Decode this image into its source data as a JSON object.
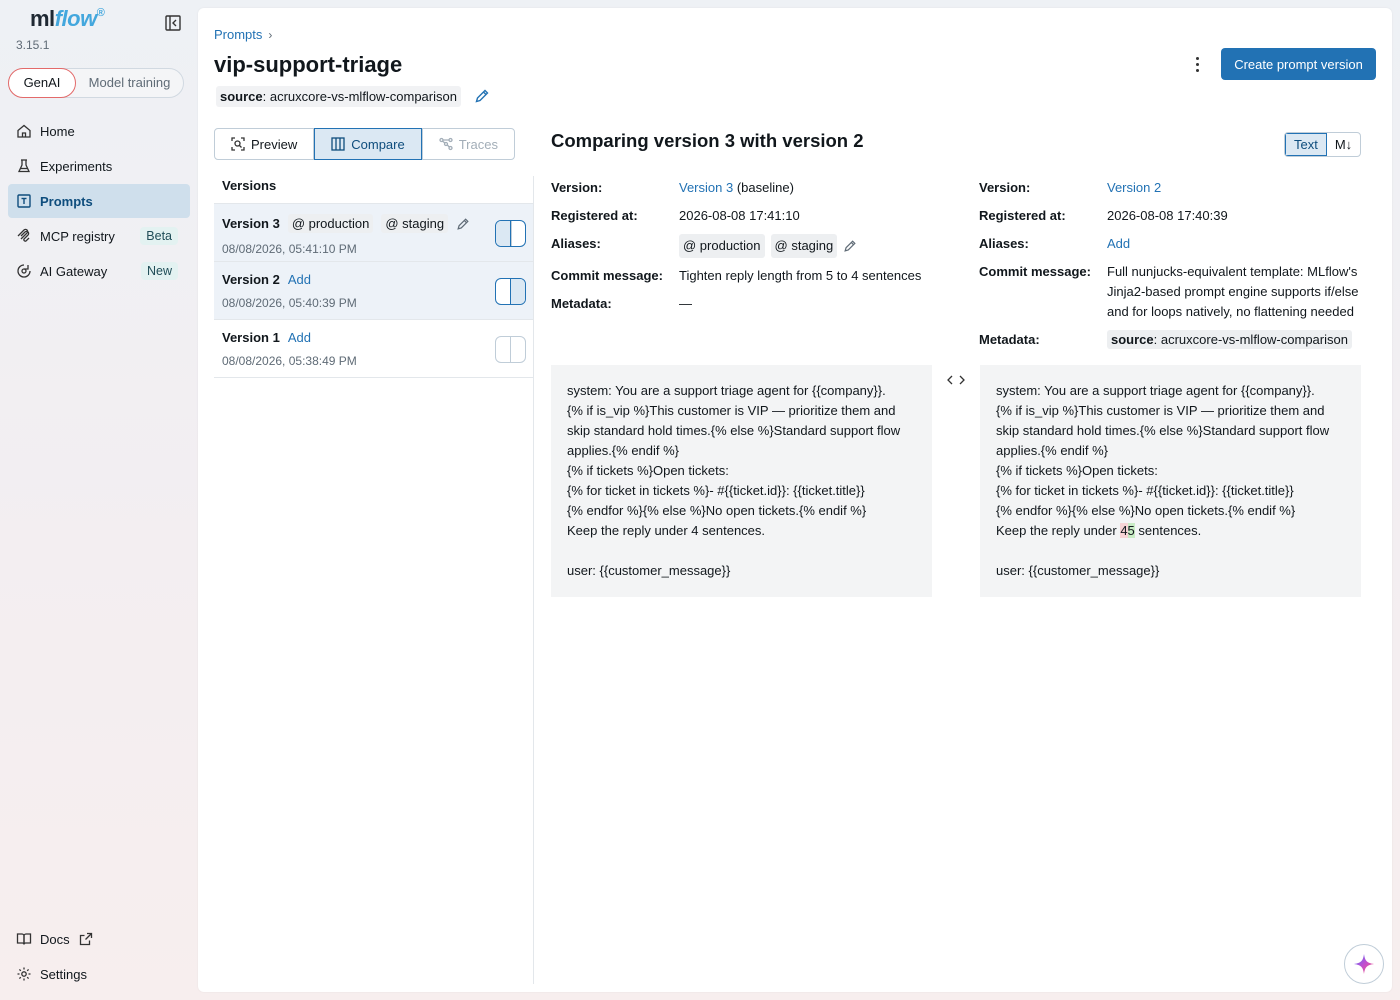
{
  "sidebar": {
    "logo": "mlflow",
    "version": "3.15.1",
    "modes": {
      "genai": "GenAI",
      "training": "Model training"
    },
    "items": [
      {
        "label": "Home",
        "icon": "home-icon"
      },
      {
        "label": "Experiments",
        "icon": "flask-icon"
      },
      {
        "label": "Prompts",
        "icon": "prompt-icon",
        "active": true
      },
      {
        "label": "MCP registry",
        "icon": "mcp-icon",
        "tag": "Beta"
      },
      {
        "label": "AI Gateway",
        "icon": "gateway-icon",
        "tag": "New"
      }
    ],
    "bottom": [
      {
        "label": "Docs",
        "icon": "book-icon"
      },
      {
        "label": "Settings",
        "icon": "gear-icon"
      }
    ]
  },
  "header": {
    "breadcrumb": "Prompts",
    "title": "vip-support-triage",
    "create_button": "Create prompt version",
    "tag": {
      "key": "source",
      "value": ": acruxcore-vs-mlflow-comparison"
    }
  },
  "toolbar": {
    "preview": "Preview",
    "compare": "Compare",
    "traces": "Traces"
  },
  "versions": {
    "header": "Versions",
    "rows": [
      {
        "name": "Version 3",
        "aliases": [
          "@ production",
          "@ staging"
        ],
        "date": "08/08/2026, 05:41:10 PM"
      },
      {
        "name": "Version 2",
        "add": "Add",
        "date": "08/08/2026, 05:40:39 PM"
      },
      {
        "name": "Version 1",
        "add": "Add",
        "date": "08/08/2026, 05:38:49 PM"
      }
    ]
  },
  "compare": {
    "title": "Comparing version 3 with version 2",
    "format_text": "Text",
    "format_md": "M↓",
    "labels": {
      "version": "Version:",
      "registered": "Registered at:",
      "aliases": "Aliases:",
      "commit": "Commit message:",
      "metadata": "Metadata:"
    },
    "left": {
      "version_link": "Version 3",
      "version_suffix": " (baseline)",
      "registered": "2026-08-08 17:41:10",
      "aliases": [
        "@ production",
        "@ staging"
      ],
      "commit": "Tighten reply length from 5 to 4 sentences",
      "metadata": "—",
      "prompt_lines": [
        "system: You are a support triage agent for {{company}}.",
        "{% if is_vip %}This customer is VIP — prioritize them and skip standard hold times.{% else %}Standard support flow applies.{% endif %}",
        "{% if tickets %}Open tickets:",
        "{% for ticket in tickets %}- #{{ticket.id}}: {{ticket.title}}",
        "{% endfor %}{% else %}No open tickets.{% endif %}",
        "Keep the reply under 4 sentences.",
        "",
        "user: {{customer_message}}"
      ]
    },
    "right": {
      "version_link": "Version 2",
      "registered": "2026-08-08 17:40:39",
      "aliases_add": "Add",
      "commit": "Full nunjucks-equivalent template: MLflow's Jinja2-based prompt engine supports if/else and for loops natively, no flattening needed",
      "metadata_key": "source",
      "metadata_value": ": acruxcore-vs-mlflow-comparison",
      "prompt_lines": [
        "system: You are a support triage agent for {{company}}.",
        "{% if is_vip %}This customer is VIP — prioritize them and skip standard hold times.{% else %}Standard support flow applies.{% endif %}",
        "{% if tickets %}Open tickets:",
        "{% for ticket in tickets %}- #{{ticket.id}}: {{ticket.title}}",
        "{% endfor %}{% else %}No open tickets.{% endif %}"
      ],
      "diff_line": {
        "before": "Keep the reply under ",
        "removed": "4",
        "added": "5",
        "after": " sentences."
      },
      "prompt_tail": [
        "",
        "user: {{customer_message}}"
      ]
    }
  },
  "colors": {
    "accent": "#2272b4",
    "active_nav_bg": "#cfdfec",
    "diff_removed": "#f7d4d6",
    "diff_added": "#c9ecc5"
  }
}
